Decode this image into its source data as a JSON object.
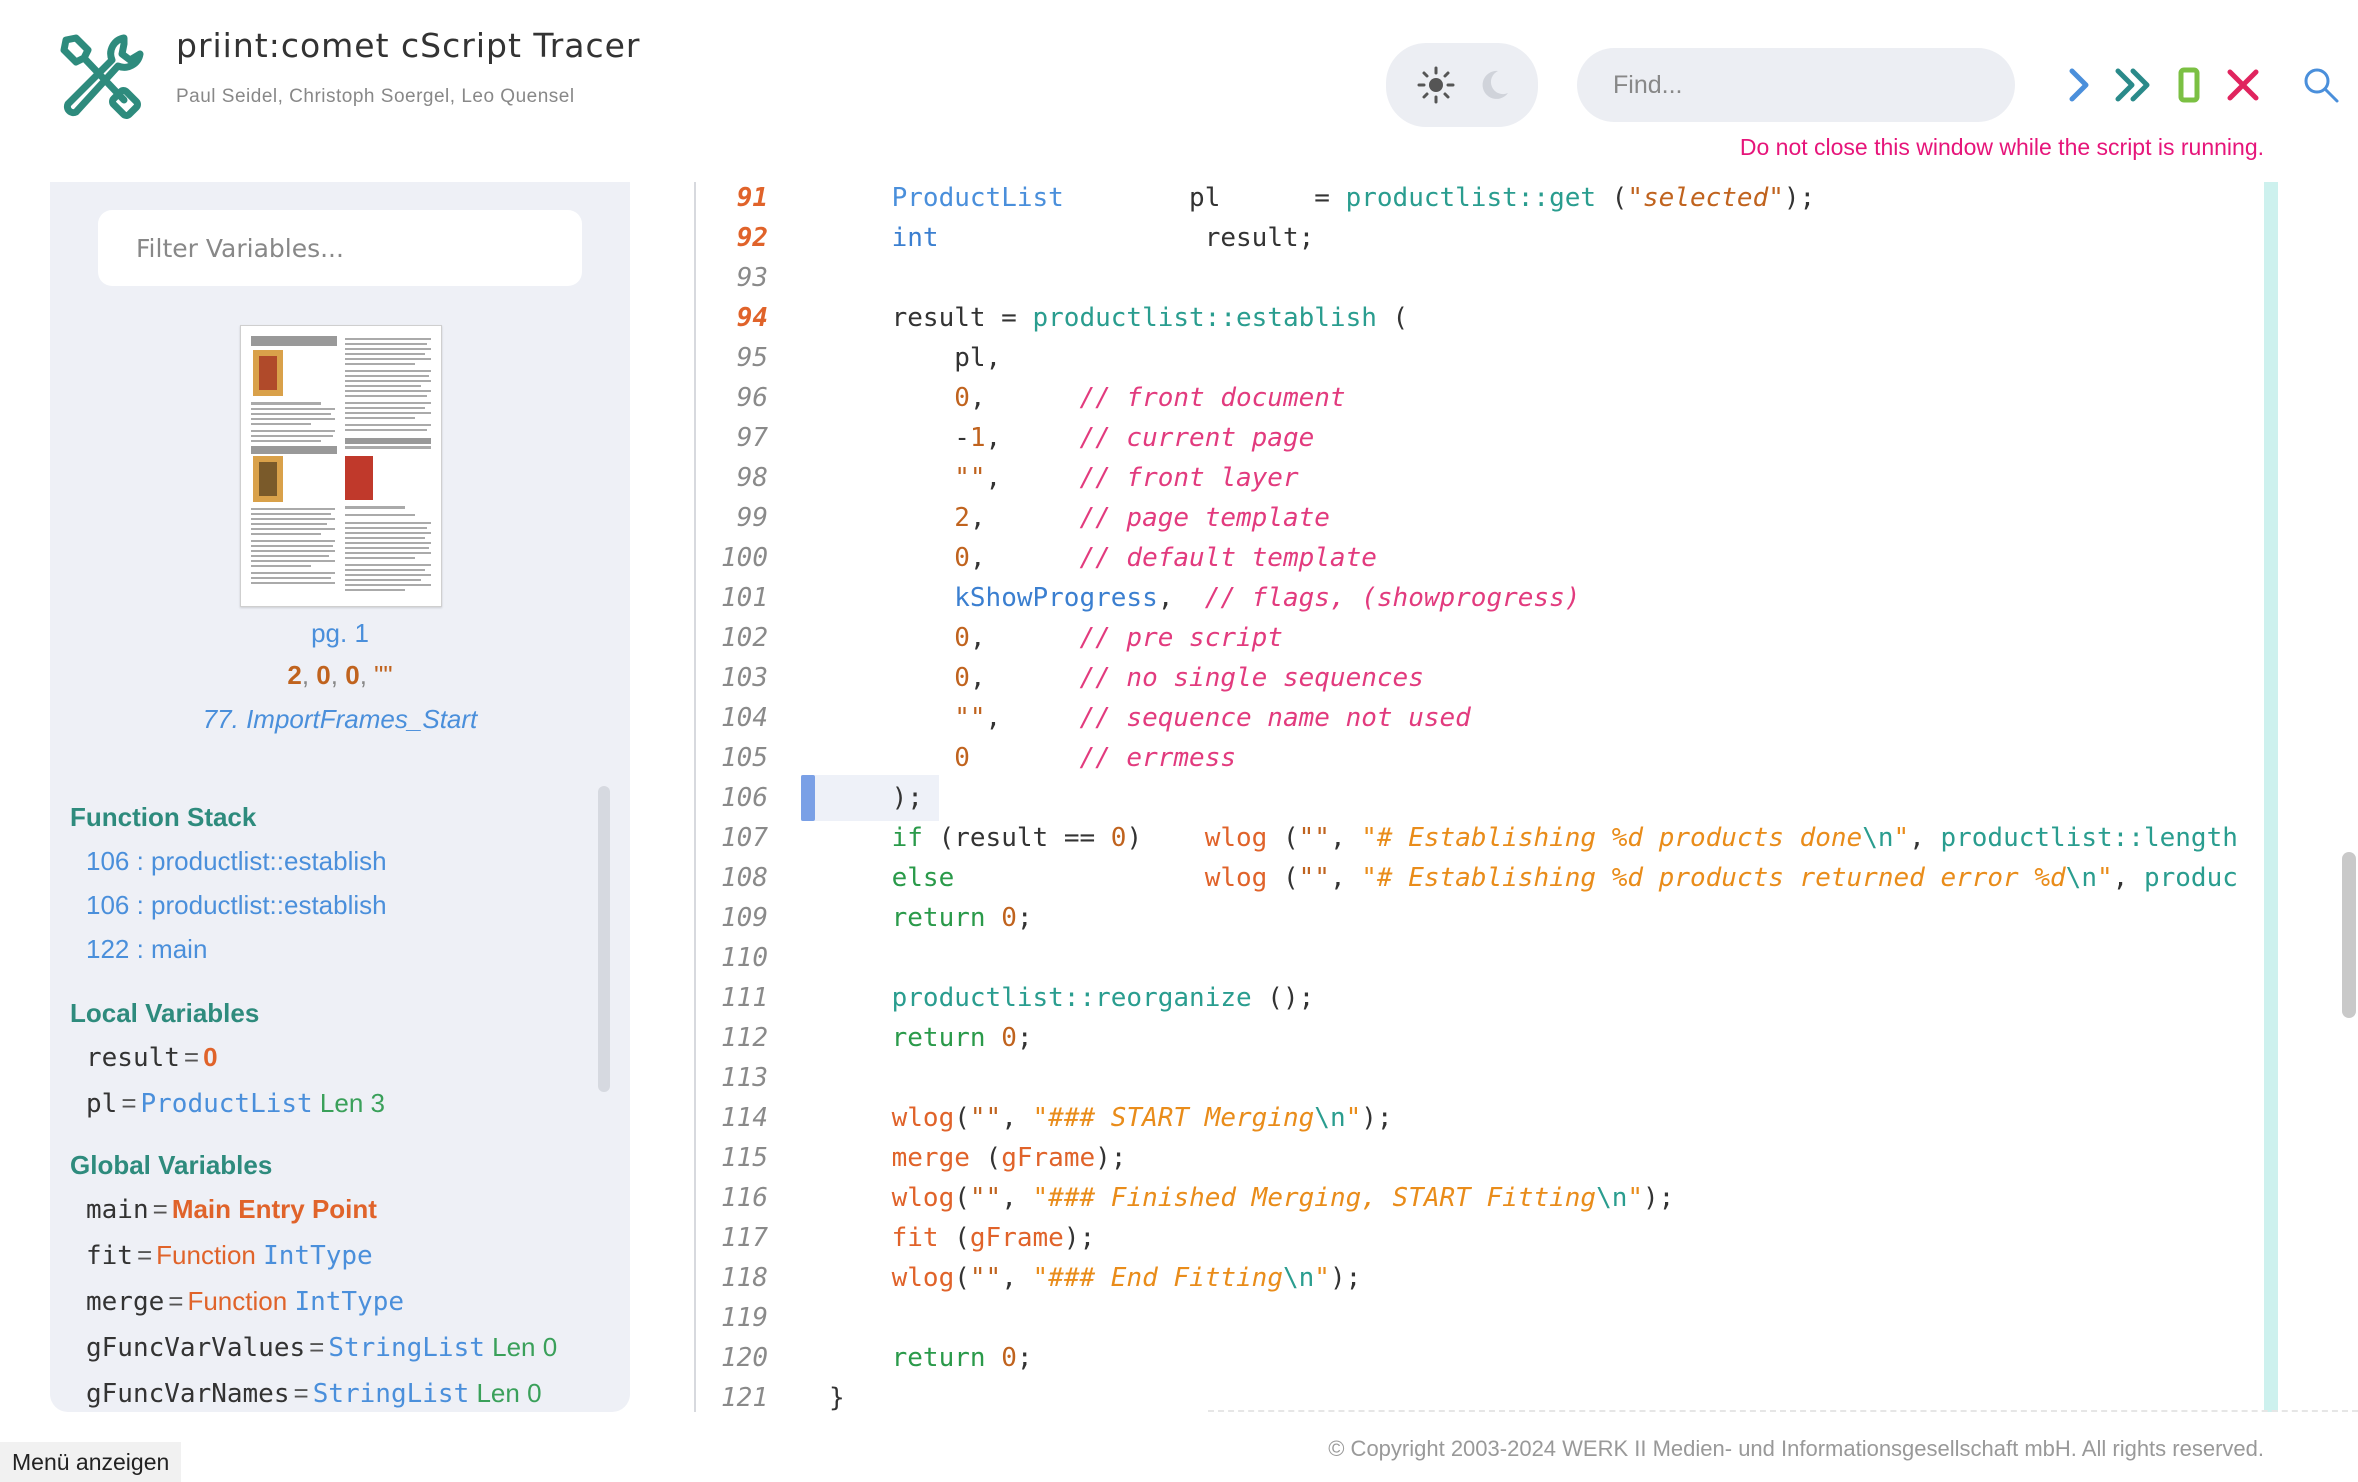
{
  "header": {
    "title": "priint:comet cScript Tracer",
    "authors": "Paul Seidel, Christoph Soergel, Leo Quensel",
    "find_placeholder": "Find...",
    "warning": "Do not close this window while the script is running."
  },
  "toolbar": {
    "continue_icon": "chevron-right-icon",
    "run_to_end_icon": "double-chevron-right-icon",
    "stop_icon": "stop-bar-icon",
    "close_icon": "x-icon",
    "search_icon": "magnifier-icon"
  },
  "sidebar": {
    "filter_placeholder": "Filter Variables...",
    "page": {
      "label": "pg. 1",
      "p1": "2",
      "p2": "0",
      "p3": "0",
      "p4": "\"\"",
      "func": "77. ImportFrames_Start"
    },
    "function_stack": {
      "title": "Function Stack",
      "items": [
        "106 : productlist::establish",
        "106 : productlist::establish",
        "122 : main"
      ]
    },
    "local_variables": {
      "title": "Local Variables",
      "items": [
        {
          "name": "result",
          "value": "0",
          "type": "",
          "len": ""
        },
        {
          "name": "pl",
          "value": "",
          "type": "ProductList",
          "len": "Len 3"
        }
      ]
    },
    "global_variables": {
      "title": "Global Variables",
      "items": [
        {
          "name": "main",
          "value": "Main Entry Point",
          "type": "",
          "len": ""
        },
        {
          "name": "fit",
          "value": "Function",
          "type": "IntType",
          "len": ""
        },
        {
          "name": "merge",
          "value": "Function",
          "type": "IntType",
          "len": ""
        },
        {
          "name": "gFuncVarValues",
          "value": "",
          "type": "StringList",
          "len": "Len 0"
        },
        {
          "name": "gFuncVarNames",
          "value": "",
          "type": "StringList",
          "len": "Len 0"
        }
      ]
    }
  },
  "code": {
    "current_line": 106,
    "lines": [
      {
        "n": "91",
        "hit": true,
        "tokens": [
          [
            "",
            "    "
          ],
          [
            "k-cls",
            "ProductList"
          ],
          [
            "",
            "        pl      = "
          ],
          [
            "k-teal",
            "productlist::get"
          ],
          [
            "",
            " ("
          ],
          [
            "k-strq",
            "\"selected\""
          ],
          [
            "",
            ");"
          ]
        ]
      },
      {
        "n": "92",
        "hit": true,
        "tokens": [
          [
            "",
            "    "
          ],
          [
            "k-blue",
            "int"
          ],
          [
            "",
            "                 result;"
          ]
        ]
      },
      {
        "n": "93",
        "hit": false,
        "tokens": []
      },
      {
        "n": "94",
        "hit": true,
        "tokens": [
          [
            "",
            "    result = "
          ],
          [
            "k-teal",
            "productlist::establish"
          ],
          [
            "",
            " ("
          ]
        ]
      },
      {
        "n": "95",
        "hit": false,
        "tokens": [
          [
            "",
            "        pl,"
          ]
        ]
      },
      {
        "n": "96",
        "hit": false,
        "tokens": [
          [
            "",
            "        "
          ],
          [
            "k-num",
            "0"
          ],
          [
            "",
            ",      "
          ],
          [
            "k-pink",
            "// front document"
          ]
        ]
      },
      {
        "n": "97",
        "hit": false,
        "tokens": [
          [
            "",
            "        -"
          ],
          [
            "k-num",
            "1"
          ],
          [
            "",
            ",     "
          ],
          [
            "k-pink",
            "// current page"
          ]
        ]
      },
      {
        "n": "98",
        "hit": false,
        "tokens": [
          [
            "",
            "        "
          ],
          [
            "k-strq",
            "\"\""
          ],
          [
            "",
            ",     "
          ],
          [
            "k-pink",
            "// front layer"
          ]
        ]
      },
      {
        "n": "99",
        "hit": false,
        "tokens": [
          [
            "",
            "        "
          ],
          [
            "k-num",
            "2"
          ],
          [
            "",
            ",      "
          ],
          [
            "k-pink",
            "// page template"
          ]
        ]
      },
      {
        "n": "100",
        "hit": false,
        "tokens": [
          [
            "",
            "        "
          ],
          [
            "k-num",
            "0"
          ],
          [
            "",
            ",      "
          ],
          [
            "k-pink",
            "// default template"
          ]
        ]
      },
      {
        "n": "101",
        "hit": false,
        "tokens": [
          [
            "",
            "        "
          ],
          [
            "k-blue",
            "kShowProgress"
          ],
          [
            "",
            ",  "
          ],
          [
            "k-pink",
            "// flags, (showprogress)"
          ]
        ]
      },
      {
        "n": "102",
        "hit": false,
        "tokens": [
          [
            "",
            "        "
          ],
          [
            "k-num",
            "0"
          ],
          [
            "",
            ",      "
          ],
          [
            "k-pink",
            "// pre script"
          ]
        ]
      },
      {
        "n": "103",
        "hit": false,
        "tokens": [
          [
            "",
            "        "
          ],
          [
            "k-num",
            "0"
          ],
          [
            "",
            ",      "
          ],
          [
            "k-pink",
            "// no single sequences"
          ]
        ]
      },
      {
        "n": "104",
        "hit": false,
        "tokens": [
          [
            "",
            "        "
          ],
          [
            "k-strq",
            "\"\""
          ],
          [
            "",
            ",     "
          ],
          [
            "k-pink",
            "// sequence name not used"
          ]
        ]
      },
      {
        "n": "105",
        "hit": false,
        "tokens": [
          [
            "",
            "        "
          ],
          [
            "k-num",
            "0"
          ],
          [
            "",
            "       "
          ],
          [
            "k-pink",
            "// errmess"
          ]
        ]
      },
      {
        "n": "106",
        "hit": false,
        "tokens": [
          [
            "",
            "    );"
          ]
        ]
      },
      {
        "n": "107",
        "hit": false,
        "tokens": [
          [
            "",
            "    "
          ],
          [
            "k-green",
            "if"
          ],
          [
            "",
            " (result == "
          ],
          [
            "k-num",
            "0"
          ],
          [
            "",
            ")    "
          ],
          [
            "k-fn",
            "wlog"
          ],
          [
            "",
            " ("
          ],
          [
            "k-strq",
            "\"\""
          ],
          [
            "",
            ", "
          ],
          [
            "k-str",
            "\"# Establishing %d products done"
          ],
          [
            "k-esc",
            "\\n"
          ],
          [
            "k-str",
            "\""
          ],
          [
            "",
            ", "
          ],
          [
            "k-teal",
            "productlist::length"
          ]
        ]
      },
      {
        "n": "108",
        "hit": false,
        "tokens": [
          [
            "",
            "    "
          ],
          [
            "k-green",
            "else"
          ],
          [
            "",
            "                "
          ],
          [
            "k-fn",
            "wlog"
          ],
          [
            "",
            " ("
          ],
          [
            "k-strq",
            "\"\""
          ],
          [
            "",
            ", "
          ],
          [
            "k-str",
            "\"# Establishing %d products returned error %d"
          ],
          [
            "k-esc",
            "\\n"
          ],
          [
            "k-str",
            "\""
          ],
          [
            "",
            ", "
          ],
          [
            "k-teal",
            "produc"
          ]
        ]
      },
      {
        "n": "109",
        "hit": false,
        "tokens": [
          [
            "",
            "    "
          ],
          [
            "k-green",
            "return"
          ],
          [
            "",
            " "
          ],
          [
            "k-num",
            "0"
          ],
          [
            "",
            ";"
          ]
        ]
      },
      {
        "n": "110",
        "hit": false,
        "tokens": []
      },
      {
        "n": "111",
        "hit": false,
        "tokens": [
          [
            "",
            "    "
          ],
          [
            "k-teal",
            "productlist::reorganize"
          ],
          [
            "",
            " ();"
          ]
        ]
      },
      {
        "n": "112",
        "hit": false,
        "tokens": [
          [
            "",
            "    "
          ],
          [
            "k-green",
            "return"
          ],
          [
            "",
            " "
          ],
          [
            "k-num",
            "0"
          ],
          [
            "",
            ";"
          ]
        ]
      },
      {
        "n": "113",
        "hit": false,
        "tokens": []
      },
      {
        "n": "114",
        "hit": false,
        "tokens": [
          [
            "",
            "    "
          ],
          [
            "k-fn",
            "wlog"
          ],
          [
            "",
            "("
          ],
          [
            "k-strq",
            "\"\""
          ],
          [
            "",
            ", "
          ],
          [
            "k-str",
            "\"### START Merging"
          ],
          [
            "k-esc",
            "\\n"
          ],
          [
            "k-str",
            "\""
          ],
          [
            "",
            ");"
          ]
        ]
      },
      {
        "n": "115",
        "hit": false,
        "tokens": [
          [
            "",
            "    "
          ],
          [
            "k-fn",
            "merge"
          ],
          [
            "",
            " ("
          ],
          [
            "k-fn",
            "gFrame"
          ],
          [
            "",
            ");"
          ]
        ]
      },
      {
        "n": "116",
        "hit": false,
        "tokens": [
          [
            "",
            "    "
          ],
          [
            "k-fn",
            "wlog"
          ],
          [
            "",
            "("
          ],
          [
            "k-strq",
            "\"\""
          ],
          [
            "",
            ", "
          ],
          [
            "k-str",
            "\"### Finished Merging, START Fitting"
          ],
          [
            "k-esc",
            "\\n"
          ],
          [
            "k-str",
            "\""
          ],
          [
            "",
            ");"
          ]
        ]
      },
      {
        "n": "117",
        "hit": false,
        "tokens": [
          [
            "",
            "    "
          ],
          [
            "k-fn",
            "fit"
          ],
          [
            "",
            " ("
          ],
          [
            "k-fn",
            "gFrame"
          ],
          [
            "",
            ");"
          ]
        ]
      },
      {
        "n": "118",
        "hit": false,
        "tokens": [
          [
            "",
            "    "
          ],
          [
            "k-fn",
            "wlog"
          ],
          [
            "",
            "("
          ],
          [
            "k-strq",
            "\"\""
          ],
          [
            "",
            ", "
          ],
          [
            "k-str",
            "\"### End Fitting"
          ],
          [
            "k-esc",
            "\\n"
          ],
          [
            "k-str",
            "\""
          ],
          [
            "",
            ");"
          ]
        ]
      },
      {
        "n": "119",
        "hit": false,
        "tokens": []
      },
      {
        "n": "120",
        "hit": false,
        "tokens": [
          [
            "",
            "    "
          ],
          [
            "k-green",
            "return"
          ],
          [
            "",
            " "
          ],
          [
            "k-num",
            "0"
          ],
          [
            "",
            ";"
          ]
        ]
      },
      {
        "n": "121",
        "hit": false,
        "tokens": [
          [
            "",
            "}"
          ]
        ]
      }
    ]
  },
  "footer": {
    "menu_label": "Menü anzeigen",
    "copyright": "© Copyright 2003-2024 WERK II Medien- und Informationsgesellschaft mbH. All rights reserved."
  },
  "colors": {
    "accent_teal": "#2e8b7d",
    "link_blue": "#4a8fdb",
    "warning_pink": "#e6157a",
    "stop_green": "#7bc043",
    "close_red": "#e0245e"
  }
}
